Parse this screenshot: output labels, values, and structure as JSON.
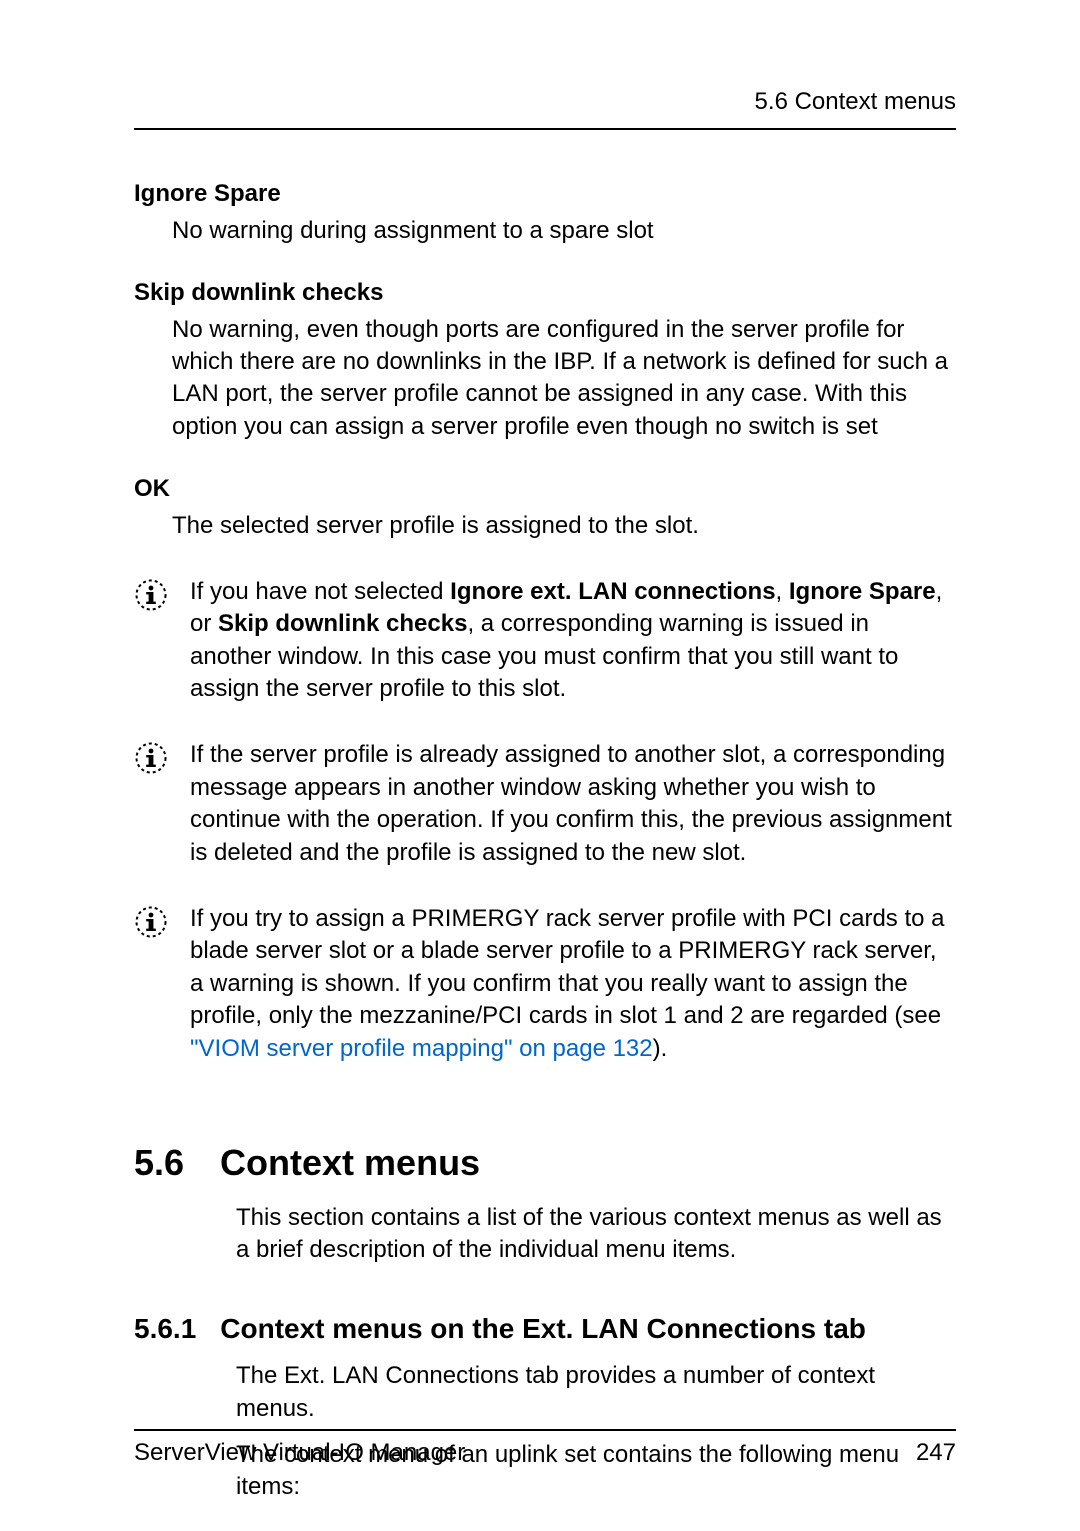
{
  "header": {
    "running_head": "5.6 Context menus"
  },
  "defs": {
    "ignore_spare": {
      "term": "Ignore Spare",
      "def": "No warning during assignment to a spare slot"
    },
    "skip_downlink": {
      "term": "Skip downlink checks",
      "def": "No warning, even though ports are configured in the server profile for which there are no downlinks in the IBP. If a network is defined for such a LAN port, the server profile cannot be assigned in any case. With this option you can assign a server profile even though no switch is set"
    },
    "ok": {
      "term": "OK",
      "def": "The selected server profile is assigned to the slot."
    }
  },
  "info": {
    "n1": {
      "pre": "If you have not selected ",
      "b1": "Ignore ext. LAN connections",
      "sep1": ", ",
      "b2": "Ignore Spare",
      "sep2": ", or ",
      "b3": "Skip downlink checks",
      "post": ", a corresponding warning is issued in another window. In this case you must confirm that you still want to assign the server profile to this slot."
    },
    "n2": "If the server profile is already assigned to another slot, a corresponding message appears in another window asking whether you wish to continue with the operation. If you confirm this, the previous assignment is deleted and the profile is assigned to the new slot.",
    "n3": {
      "pre": "If you try to assign a PRIMERGY rack server profile with PCI cards to a blade server slot or a blade server profile to a PRIMERGY rack server, a warning is shown. If you confirm that you really want to assign the profile, only the mezzanine/PCI cards in slot 1 and 2 are regarded (see ",
      "link": "\"VIOM server profile mapping\" on page 132",
      "post": ")."
    }
  },
  "h2": {
    "num": "5.6",
    "title": "Context menus",
    "body": "This section contains a list of the various context menus as well as a brief description of the individual menu items."
  },
  "h3": {
    "num": "5.6.1",
    "title": "Context menus on the Ext. LAN Connections tab",
    "p1_pre": "The ",
    "p1_bold": "Ext. LAN Connections",
    "p1_post": " tab provides a number of context menus.",
    "p2": "The context menu of an uplink set contains the following menu items:"
  },
  "footer": {
    "left": "ServerView Virtual-IO Manager",
    "right": "247"
  }
}
